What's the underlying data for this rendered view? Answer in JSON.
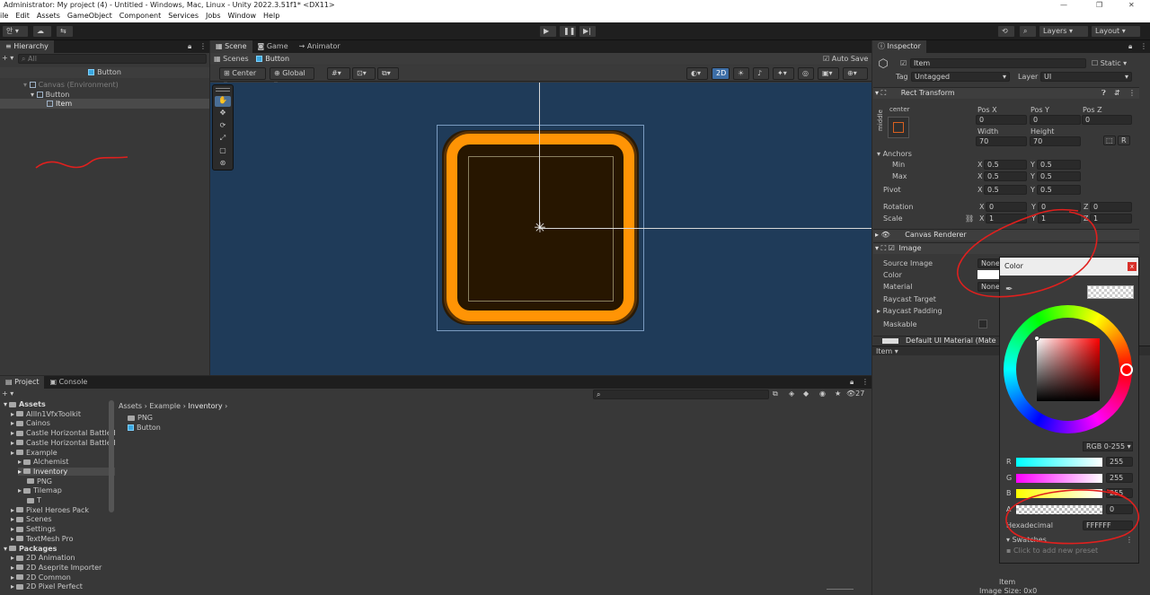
{
  "titlebar": {
    "text": "Administrator: My project (4) - Untitled - Windows, Mac, Linux - Unity 2022.3.51f1* <DX11>"
  },
  "menu": [
    "ile",
    "Edit",
    "Assets",
    "GameObject",
    "Component",
    "Services",
    "Jobs",
    "Window",
    "Help"
  ],
  "toolbar": {
    "account": "안 ▾",
    "layers": "Layers",
    "layout": "Layout"
  },
  "hierarchy": {
    "tab": "Hierarchy",
    "search_placeholder": "All",
    "scene_root": "Button",
    "items": [
      "Canvas (Environment)",
      "Button",
      "Item"
    ]
  },
  "scene": {
    "tabs": [
      "Scene",
      "Game",
      "Animator"
    ],
    "breadcrumb_scenes": "Scenes",
    "breadcrumb_button": "Button",
    "auto_save": "Auto Save",
    "pivot_mode": "Center",
    "space_mode": "Global",
    "mode_2d": "2D"
  },
  "project": {
    "tabs": [
      "Project",
      "Console"
    ],
    "count": "27",
    "breadcrumb": [
      "Assets",
      "Example",
      "Inventory"
    ],
    "tree": [
      {
        "label": "Assets",
        "level": 0,
        "bold": true
      },
      {
        "label": "AllIn1VfxToolkit",
        "level": 1
      },
      {
        "label": "Cainos",
        "level": 1
      },
      {
        "label": "Castle Horizontal Battle B",
        "level": 1
      },
      {
        "label": "Castle Horizontal Battle B",
        "level": 1
      },
      {
        "label": "Example",
        "level": 1
      },
      {
        "label": "Alchemist",
        "level": 2
      },
      {
        "label": "Inventory",
        "level": 2,
        "selected": true
      },
      {
        "label": "PNG",
        "level": 3
      },
      {
        "label": "Tilemap",
        "level": 2
      },
      {
        "label": "T",
        "level": 3
      },
      {
        "label": "Pixel Heroes Pack",
        "level": 1
      },
      {
        "label": "Scenes",
        "level": 1
      },
      {
        "label": "Settings",
        "level": 1
      },
      {
        "label": "TextMesh Pro",
        "level": 1
      },
      {
        "label": "Packages",
        "level": 0,
        "bold": true
      },
      {
        "label": "2D Animation",
        "level": 1
      },
      {
        "label": "2D Aseprite Importer",
        "level": 1
      },
      {
        "label": "2D Common",
        "level": 1
      },
      {
        "label": "2D Pixel Perfect",
        "level": 1
      }
    ],
    "files": [
      "PNG",
      "Button"
    ]
  },
  "inspector": {
    "tab": "Inspector",
    "object_name": "Item",
    "static_label": "Static",
    "tag_label": "Tag",
    "tag_value": "Untagged",
    "layer_label": "Layer",
    "layer_value": "UI",
    "rect_transform": {
      "title": "Rect Transform",
      "anchor_h": "center",
      "anchor_v": "middle",
      "pos_x_label": "Pos X",
      "pos_x": "0",
      "pos_y_label": "Pos Y",
      "pos_y": "0",
      "pos_z_label": "Pos Z",
      "pos_z": "0",
      "width_label": "Width",
      "width": "70",
      "height_label": "Height",
      "height": "70",
      "r_btn": "R",
      "anchors": "Anchors",
      "min": "Min",
      "min_x": "0.5",
      "min_y": "0.5",
      "max": "Max",
      "max_x": "0.5",
      "max_y": "0.5",
      "pivot": "Pivot",
      "pivot_x": "0.5",
      "pivot_y": "0.5",
      "rotation": "Rotation",
      "rot_x": "0",
      "rot_y": "0",
      "rot_z": "0",
      "scale": "Scale",
      "scale_x": "1",
      "scale_y": "1",
      "scale_z": "1",
      "axis_x": "X",
      "axis_y": "Y",
      "axis_z": "Z"
    },
    "canvas_renderer": "Canvas Renderer",
    "image": {
      "title": "Image",
      "source_image": "Source Image",
      "source_value": "None",
      "color": "Color",
      "material": "Material",
      "material_value": "None",
      "raycast_target": "Raycast Target",
      "raycast_padding": "Raycast Padding",
      "maskable": "Maskable"
    },
    "material_row": "Default UI Material (Mate",
    "footer_dropdown": "Item ▾",
    "preview_name": "Item",
    "preview_size": "Image Size: 0x0"
  },
  "color_picker": {
    "title": "Color",
    "close": "x",
    "mode": "RGB 0-255 ▾",
    "r_label": "R",
    "r": "255",
    "g_label": "G",
    "g": "255",
    "b_label": "B",
    "b": "255",
    "a_label": "A",
    "a": "0",
    "hex_label": "Hexadecimal",
    "hex": "FFFFFF",
    "swatches": "Swatches",
    "add_preset": "Click to add new preset"
  },
  "colors": {
    "scene_bg": "#1f3b59",
    "orange": "#ff9405",
    "button_inner": "#271600",
    "annotation_red": "#e0201e"
  }
}
